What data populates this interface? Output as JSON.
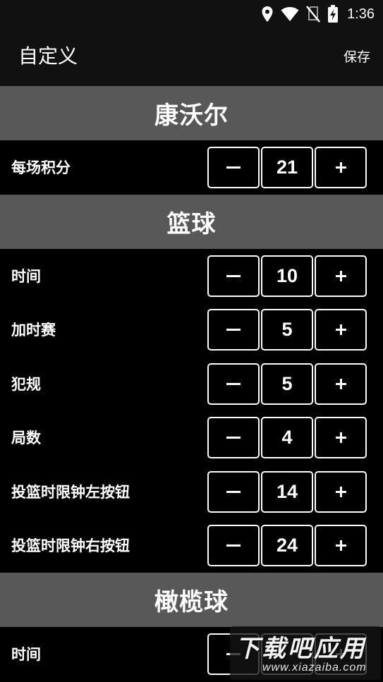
{
  "status_bar": {
    "time": "1:36",
    "icons": [
      "location-icon",
      "wifi-icon",
      "no-sim-icon",
      "battery-charging-icon"
    ]
  },
  "app_bar": {
    "title": "自定义",
    "save_label": "保存"
  },
  "sections": [
    {
      "title": "康沃尔",
      "settings": [
        {
          "label": "每场积分",
          "value": "21"
        }
      ]
    },
    {
      "title": "篮球",
      "settings": [
        {
          "label": "时间",
          "value": "10"
        },
        {
          "label": "加时赛",
          "value": "5"
        },
        {
          "label": "犯规",
          "value": "5"
        },
        {
          "label": "局数",
          "value": "4"
        },
        {
          "label": "投篮时限钟左按钮",
          "value": "14"
        },
        {
          "label": "投篮时限钟右按钮",
          "value": "24"
        }
      ]
    },
    {
      "title": "橄榄球",
      "settings": [
        {
          "label": "时间",
          "value": ""
        }
      ]
    }
  ],
  "watermark": {
    "main": "下载吧应用",
    "sub": "www.xiazaiba.com"
  },
  "colors": {
    "background": "#000000",
    "bar": "#111111",
    "section_header": "#585858",
    "text": "#ffffff"
  }
}
